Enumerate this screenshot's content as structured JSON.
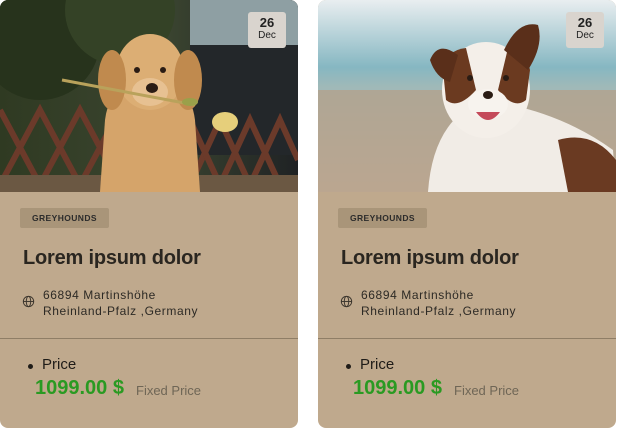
{
  "cards": [
    {
      "date": {
        "day": "26",
        "month": "Dec"
      },
      "tag": "GREYHOUNDS",
      "title": "Lorem ipsum dolor",
      "address_line1": "66894 Martinshöhe",
      "address_line2": "Rheinland-Pfalz ,Germany",
      "price_label": "Price",
      "price_value": "1099.00 $",
      "price_note": "Fixed Price",
      "image_icon": "golden-retriever-with-flower"
    },
    {
      "date": {
        "day": "26",
        "month": "Dec"
      },
      "tag": "GREYHOUNDS",
      "title": "Lorem ipsum dolor",
      "address_line1": "66894 Martinshöhe",
      "address_line2": "Rheinland-Pfalz ,Germany",
      "price_label": "Price",
      "price_value": "1099.00 $",
      "price_note": "Fixed Price",
      "image_icon": "australian-shepherd-on-beach"
    }
  ],
  "colors": {
    "card_background": "#bfa98d",
    "tag_background": "#a99579",
    "price_green": "#2a9a22",
    "badge_background": "#d9d4ce"
  }
}
